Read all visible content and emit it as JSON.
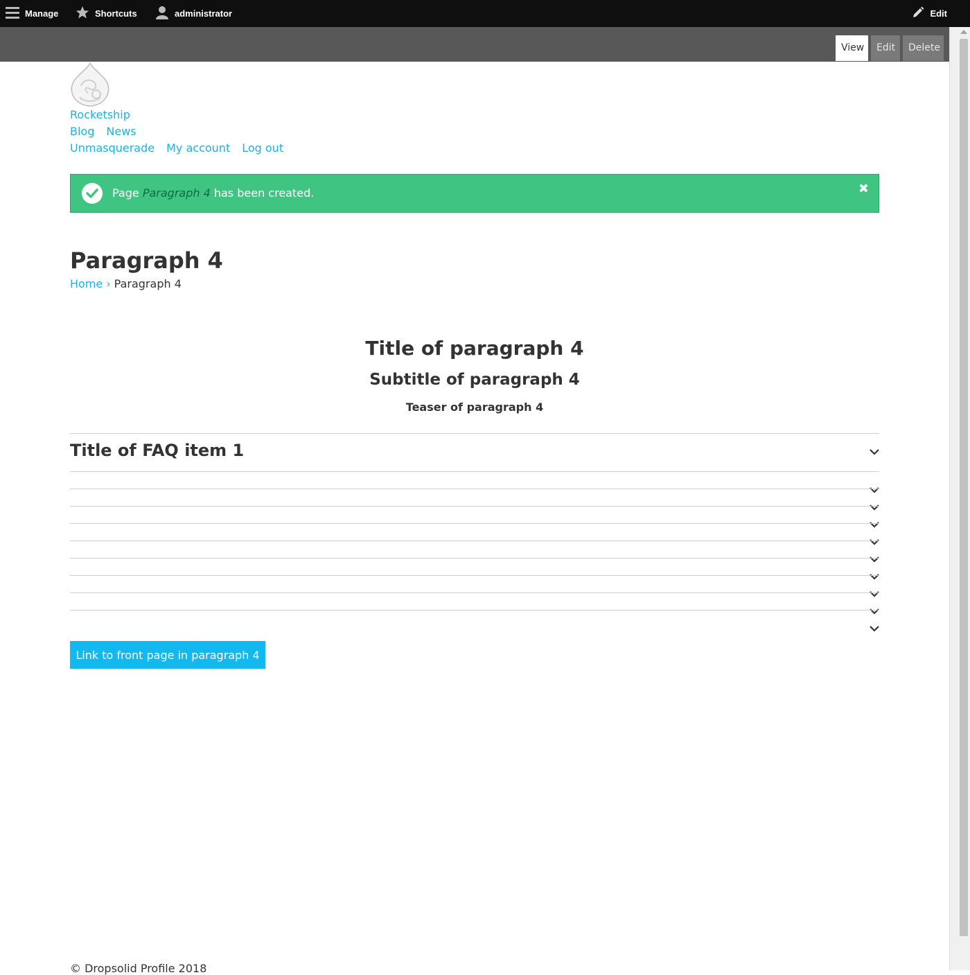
{
  "toolbar": {
    "manage": "Manage",
    "shortcuts": "Shortcuts",
    "user": "administrator",
    "edit": "Edit"
  },
  "tabs": {
    "view": "View",
    "edit": "Edit",
    "delete": "Delete"
  },
  "site": {
    "name": "Rocketship"
  },
  "main_nav": [
    "Blog",
    "News"
  ],
  "account_nav": [
    "Unmasquerade",
    "My account",
    "Log out"
  ],
  "message": {
    "prefix": "Page",
    "emphasis": "Paragraph 4",
    "suffix": "has been created.",
    "close": "✖"
  },
  "page": {
    "title": "Paragraph 4"
  },
  "breadcrumb": {
    "home": "Home",
    "separator": "›",
    "current": "Paragraph 4"
  },
  "paragraph": {
    "title": "Title of paragraph 4",
    "subtitle": "Subtitle of paragraph 4",
    "teaser": "Teaser of paragraph 4"
  },
  "faq": {
    "first_item_title": "Title of FAQ item 1"
  },
  "cta": {
    "label": "Link to front page in paragraph 4"
  },
  "footer": {
    "text": "© Dropsolid Profile 2018"
  },
  "colors": {
    "link": "#1ab2e3",
    "success": "#40c482",
    "button": "#12b9ee",
    "toolbar": "#0f0f0f"
  }
}
